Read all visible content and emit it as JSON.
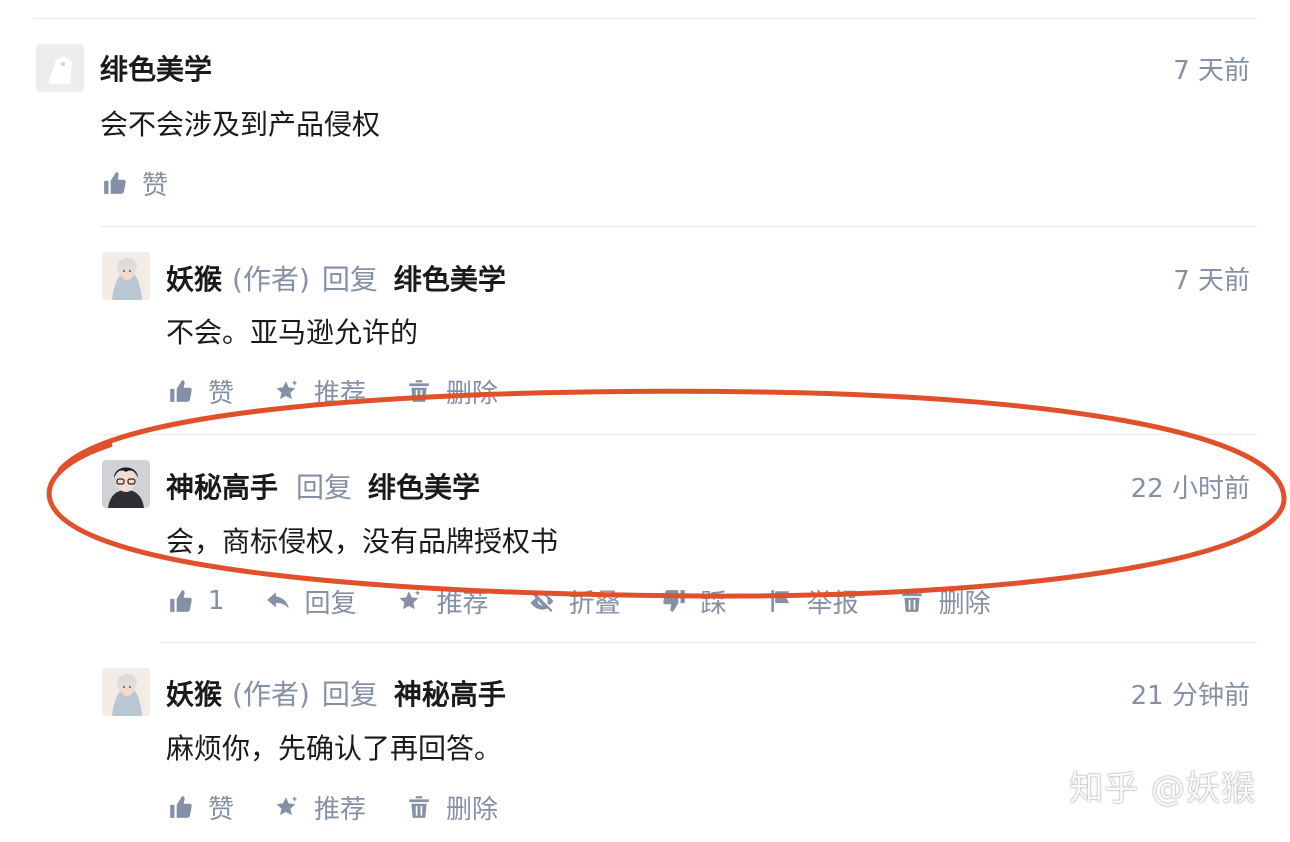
{
  "comments": [
    {
      "author": "绯色美学",
      "time": "7 天前",
      "content": "会不会涉及到产品侵权",
      "actions": {
        "like": "赞"
      }
    },
    {
      "author": "妖猴",
      "author_tag": "(作者)",
      "reply_word": "回复",
      "reply_to": "绯色美学",
      "time": "7 天前",
      "content": "不会。亚马逊允许的",
      "actions": {
        "like": "赞",
        "recommend": "推荐",
        "delete": "删除"
      }
    },
    {
      "author": "神秘高手",
      "reply_word": "回复",
      "reply_to": "绯色美学",
      "time": "22 小时前",
      "content": "会，商标侵权，没有品牌授权书",
      "actions": {
        "like": "1",
        "reply": "回复",
        "recommend": "推荐",
        "fold": "折叠",
        "dislike": "踩",
        "report": "举报",
        "delete": "删除"
      }
    },
    {
      "author": "妖猴",
      "author_tag": "(作者)",
      "reply_word": "回复",
      "reply_to": "神秘高手",
      "time": "21 分钟前",
      "content": "麻烦你，先确认了再回答。",
      "actions": {
        "like": "赞",
        "recommend": "推荐",
        "delete": "删除"
      }
    }
  ],
  "watermark": "知乎 @妖猴",
  "colors": {
    "meta_text": "#8590a6",
    "primary_text": "#1a1a1a",
    "highlight_oval": "#e0502a",
    "divider": "#ebebeb"
  },
  "icons": [
    "thumb-up-icon",
    "reply-arrow-icon",
    "star-sparkle-icon",
    "eye-off-icon",
    "thumb-down-icon",
    "flag-icon",
    "trash-icon"
  ]
}
